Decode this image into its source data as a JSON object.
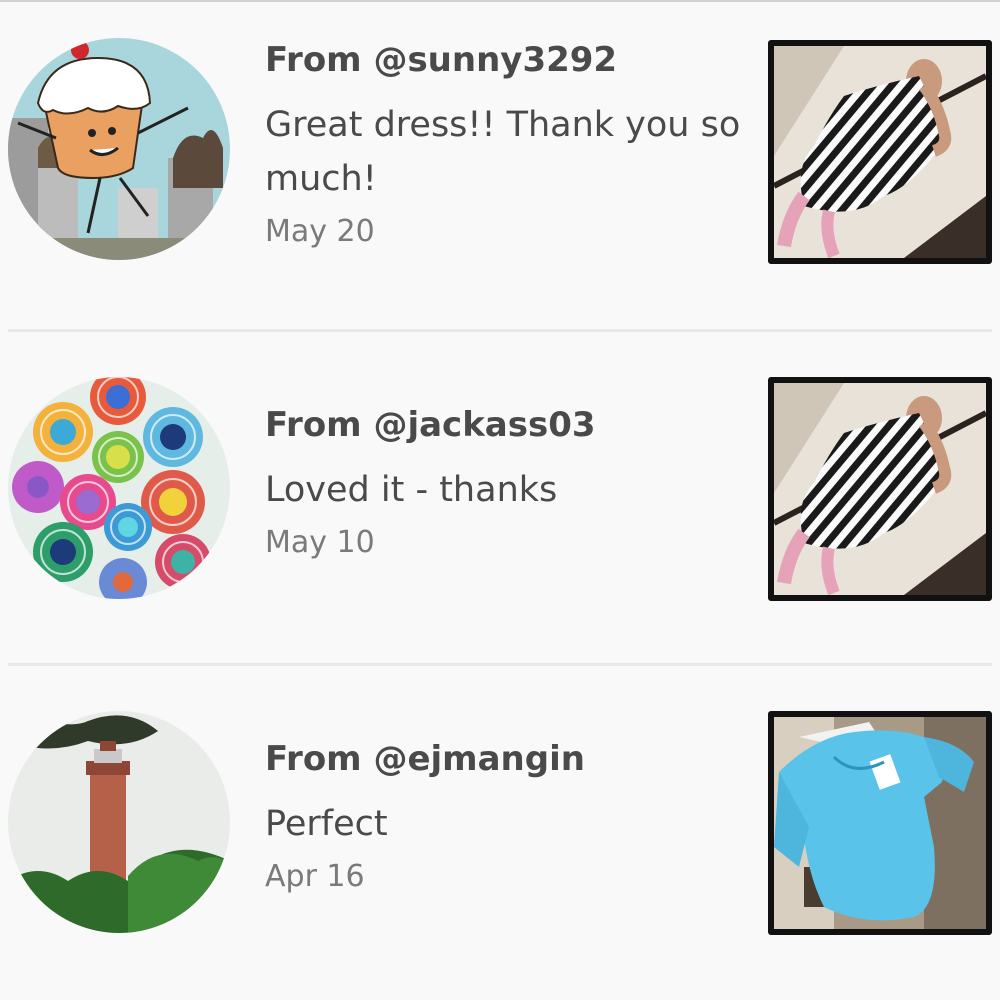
{
  "feedback": [
    {
      "from": "From @sunny3292",
      "message": "Great dress!! Thank you so much!",
      "date": "May 20",
      "avatar": "cupcake-cartoon-avatar",
      "item_image": "striped-dress-photo"
    },
    {
      "from": "From @jackass03",
      "message": "Loved it - thanks",
      "date": "May 10",
      "avatar": "flower-mosaic-avatar",
      "item_image": "striped-dress-photo"
    },
    {
      "from": "From @ejmangin",
      "message": "Perfect",
      "date": "Apr 16",
      "avatar": "tower-photo-avatar",
      "item_image": "blue-top-photo"
    }
  ],
  "colors": {
    "background": "#f9f9f9",
    "divider": "#e9e9e9",
    "text_primary": "#4a4a4a",
    "text_secondary": "#7a7a7a"
  }
}
